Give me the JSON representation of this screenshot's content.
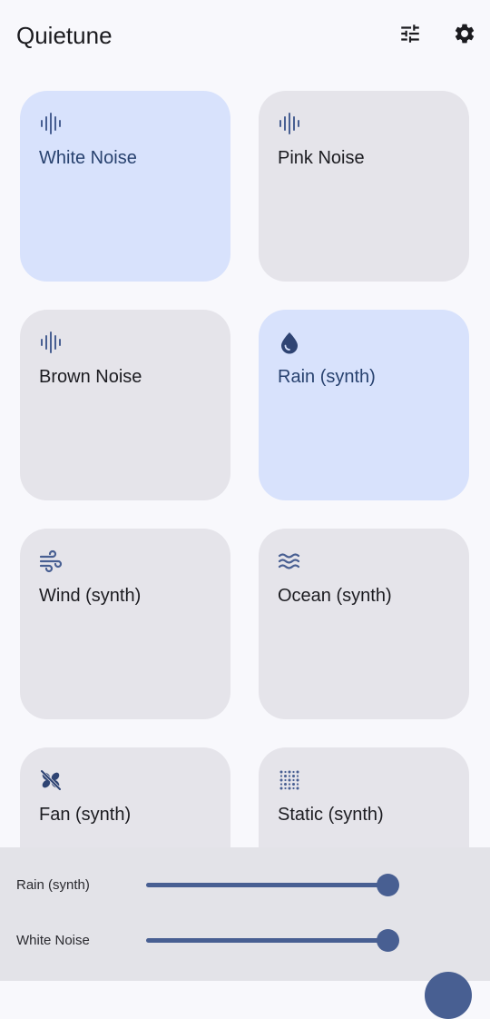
{
  "app": {
    "title": "Quietune"
  },
  "toolbar": {
    "mixer_icon": "tune-icon",
    "settings_icon": "gear-icon"
  },
  "tiles": [
    {
      "label": "White Noise",
      "icon": "waveform-icon",
      "active": true
    },
    {
      "label": "Pink Noise",
      "icon": "waveform-icon",
      "active": false
    },
    {
      "label": "Brown Noise",
      "icon": "waveform-icon",
      "active": false
    },
    {
      "label": "Rain (synth)",
      "icon": "water-drop-icon",
      "active": true
    },
    {
      "label": "Wind (synth)",
      "icon": "wind-icon",
      "active": false
    },
    {
      "label": "Ocean (synth)",
      "icon": "waves-icon",
      "active": false
    },
    {
      "label": "Fan (synth)",
      "icon": "fan-off-icon",
      "active": false
    },
    {
      "label": "Static (synth)",
      "icon": "grain-icon",
      "active": false
    }
  ],
  "mixer": {
    "channels": [
      {
        "label": "Rain (synth)",
        "volume": 1.0
      },
      {
        "label": "White Noise",
        "volume": 1.0
      }
    ]
  },
  "colors": {
    "accent": "#485f92",
    "active_tile": "#d8e2fc",
    "inactive_tile": "#e5e4ea",
    "background": "#f8f8fc"
  }
}
